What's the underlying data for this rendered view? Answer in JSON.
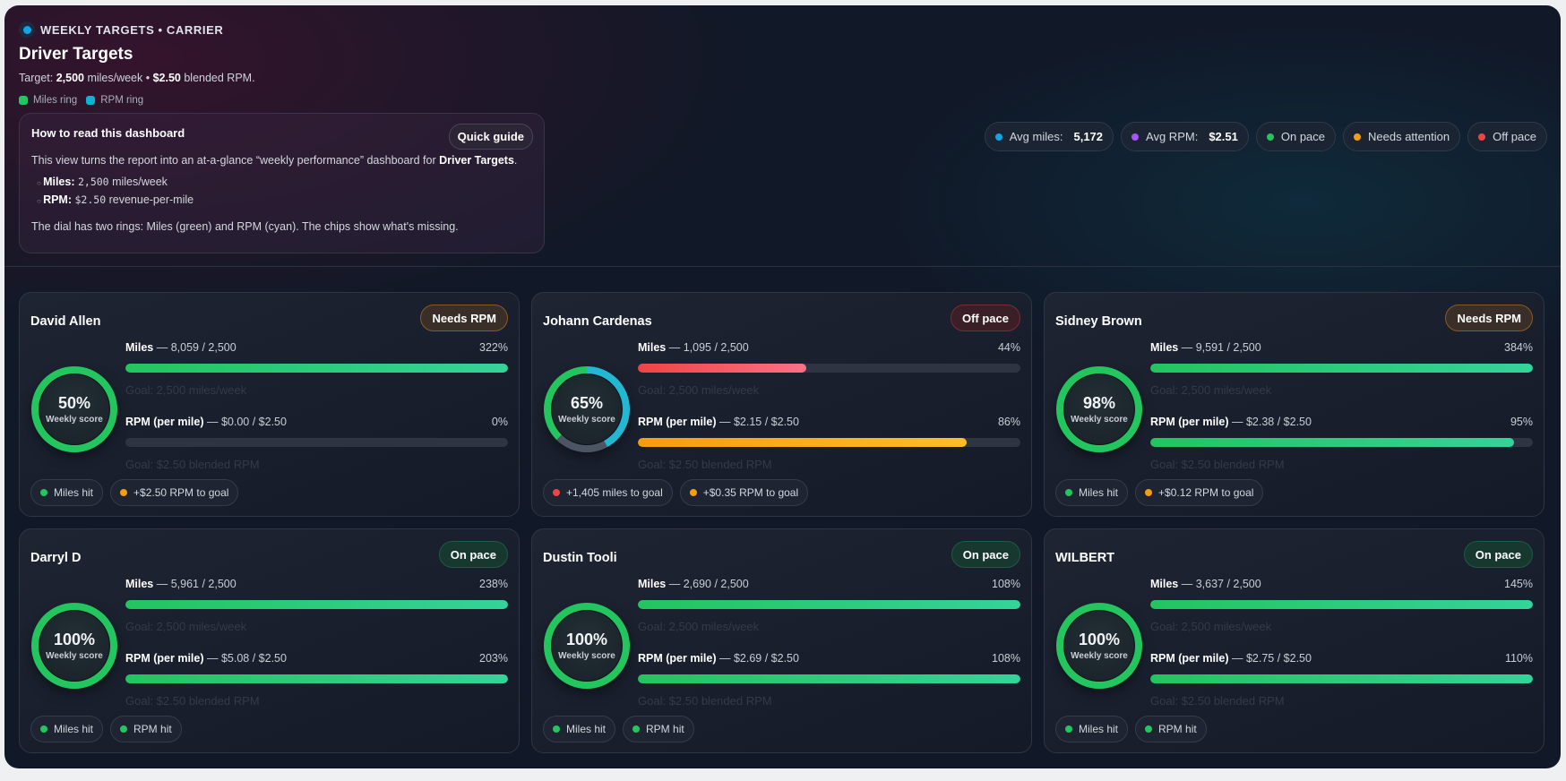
{
  "header": {
    "eyebrow": "WEEKLY TARGETS • CARRIER",
    "title": "Driver Targets",
    "sub_pre": "Target: ",
    "sub_miles": "2,500",
    "sub_mid": " miles/week • ",
    "sub_rpm": "$2.50",
    "sub_post": " blended RPM.",
    "legend": [
      {
        "label": "Miles ring",
        "color": "#22c55e"
      },
      {
        "label": "RPM ring",
        "color": "#06b6d4"
      }
    ]
  },
  "guide": {
    "title": "How to read this dashboard",
    "button": "Quick guide",
    "intro": "This view turns the report into an at-a-glance “weekly performance” dashboard for ",
    "intro_bold": "Driver Targets",
    "intro_end": ".",
    "items": [
      {
        "label": "Miles:",
        "value": "2,500",
        "rest": " miles/week"
      },
      {
        "label": "RPM:",
        "value": "$2.50",
        "rest": " revenue-per-mile"
      }
    ],
    "footer": "The dial has two rings: Miles (green) and RPM (cyan). The chips show what's missing."
  },
  "stats": [
    {
      "label": "Avg miles:",
      "value": "5,172",
      "color": "#0ea5e9"
    },
    {
      "label": "Avg RPM:",
      "value": "$2.51",
      "color": "#a855f7"
    },
    {
      "label": "On pace",
      "color": "#22c55e"
    },
    {
      "label": "Needs attention",
      "color": "#f59e0b"
    },
    {
      "label": "Off pace",
      "color": "#ef4444"
    }
  ],
  "ring_label": "Weekly score",
  "miles_label": "Miles",
  "rpm_label": "RPM (per mile)",
  "miles_goal": "Goal: 2,500 miles/week",
  "rpm_goal": "Goal: $2.50 blended RPM",
  "colors": {
    "green": "#22c55e",
    "red": "#ef4444",
    "orange": "#f59e0b",
    "cyan": "#22b8d4",
    "gray": "#4b5563"
  },
  "drivers": [
    {
      "name": "David Allen",
      "status": "Needs RPM",
      "status_tone": "warn",
      "score": "50%",
      "ring": {
        "miles": 1.0,
        "rpm": 0
      },
      "miles": "8,059 / 2,500",
      "miles_pct": "322%",
      "miles_fill": 1.0,
      "miles_tone": "green",
      "rpm": "$0.00 / $2.50",
      "rpm_pct": "0%",
      "rpm_fill": 0,
      "rpm_tone": "green",
      "chips": [
        {
          "label": "Miles hit",
          "tone": "green"
        },
        {
          "label": "+$2.50 RPM to goal",
          "tone": "orange"
        }
      ]
    },
    {
      "name": "Johann Cardenas",
      "status": "Off pace",
      "status_tone": "bad",
      "score": "65%",
      "ring": {
        "miles": 0.375,
        "rpm": 0.42
      },
      "miles": "1,095 / 2,500",
      "miles_pct": "44%",
      "miles_fill": 0.44,
      "miles_tone": "red",
      "rpm": "$2.15 / $2.50",
      "rpm_pct": "86%",
      "rpm_fill": 0.86,
      "rpm_tone": "orange",
      "chips": [
        {
          "label": "+1,405 miles to goal",
          "tone": "red"
        },
        {
          "label": "+$0.35 RPM to goal",
          "tone": "orange"
        }
      ]
    },
    {
      "name": "Sidney Brown",
      "status": "Needs RPM",
      "status_tone": "warn",
      "score": "98%",
      "ring": {
        "miles": 1.0,
        "rpm": 0
      },
      "miles": "9,591 / 2,500",
      "miles_pct": "384%",
      "miles_fill": 1.0,
      "miles_tone": "green",
      "rpm": "$2.38 / $2.50",
      "rpm_pct": "95%",
      "rpm_fill": 0.95,
      "rpm_tone": "green",
      "chips": [
        {
          "label": "Miles hit",
          "tone": "green"
        },
        {
          "label": "+$0.12 RPM to goal",
          "tone": "orange"
        }
      ]
    },
    {
      "name": "Darryl D",
      "status": "On pace",
      "status_tone": "good",
      "score": "100%",
      "ring": {
        "miles": 1.0,
        "rpm": 0
      },
      "miles": "5,961 / 2,500",
      "miles_pct": "238%",
      "miles_fill": 1.0,
      "miles_tone": "green",
      "rpm": "$5.08 / $2.50",
      "rpm_pct": "203%",
      "rpm_fill": 1.0,
      "rpm_tone": "green",
      "chips": [
        {
          "label": "Miles hit",
          "tone": "green"
        },
        {
          "label": "RPM hit",
          "tone": "green"
        }
      ]
    },
    {
      "name": "Dustin Tooli",
      "status": "On pace",
      "status_tone": "good",
      "score": "100%",
      "ring": {
        "miles": 1.0,
        "rpm": 0
      },
      "miles": "2,690 / 2,500",
      "miles_pct": "108%",
      "miles_fill": 1.0,
      "miles_tone": "green",
      "rpm": "$2.69 / $2.50",
      "rpm_pct": "108%",
      "rpm_fill": 1.0,
      "rpm_tone": "green",
      "chips": [
        {
          "label": "Miles hit",
          "tone": "green"
        },
        {
          "label": "RPM hit",
          "tone": "green"
        }
      ]
    },
    {
      "name": "WILBERT",
      "status": "On pace",
      "status_tone": "good",
      "score": "100%",
      "ring": {
        "miles": 1.0,
        "rpm": 0
      },
      "miles": "3,637 / 2,500",
      "miles_pct": "145%",
      "miles_fill": 1.0,
      "miles_tone": "green",
      "rpm": "$2.75 / $2.50",
      "rpm_pct": "110%",
      "rpm_fill": 1.0,
      "rpm_tone": "green",
      "chips": [
        {
          "label": "Miles hit",
          "tone": "green"
        },
        {
          "label": "RPM hit",
          "tone": "green"
        }
      ]
    }
  ]
}
